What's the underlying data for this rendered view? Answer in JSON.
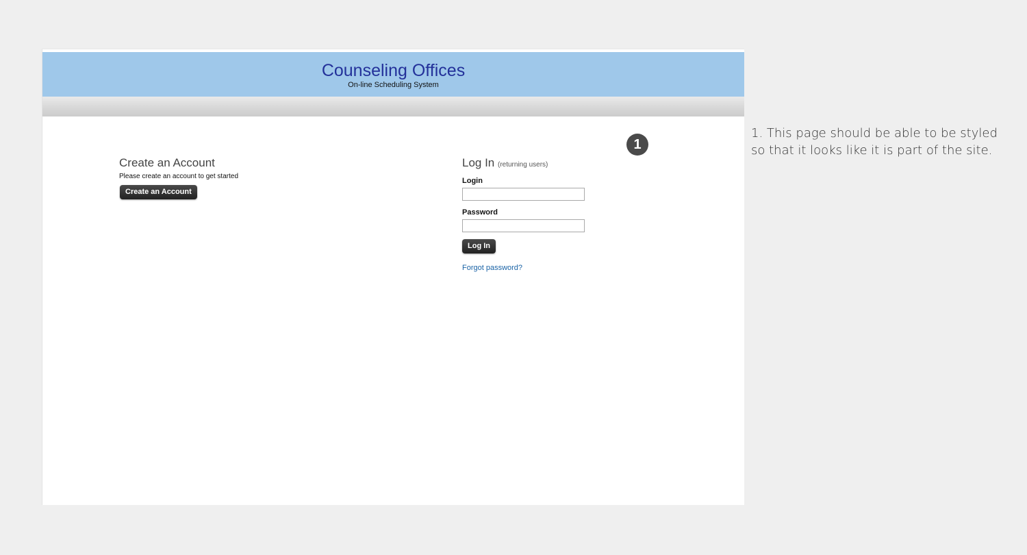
{
  "header": {
    "title": "Counseling Offices",
    "subtitle": "On-line Scheduling System"
  },
  "step_marker": {
    "number": "1"
  },
  "create_account": {
    "title": "Create an Account",
    "description": "Please create an account to get started",
    "button_label": "Create an Account"
  },
  "login": {
    "title": "Log In",
    "note": "(returning users)",
    "login_label": "Login",
    "login_value": "",
    "password_label": "Password",
    "password_value": "",
    "button_label": "Log In",
    "forgot_link": "Forgot password?"
  },
  "annotation": {
    "text": "1. This page should be able to be styled so that it looks like it is part of the site."
  },
  "colors": {
    "header_bg": "#9fc8ea",
    "title_color": "#23319a",
    "link_color": "#1a63a6",
    "button_bg": "#2e2e2e"
  }
}
